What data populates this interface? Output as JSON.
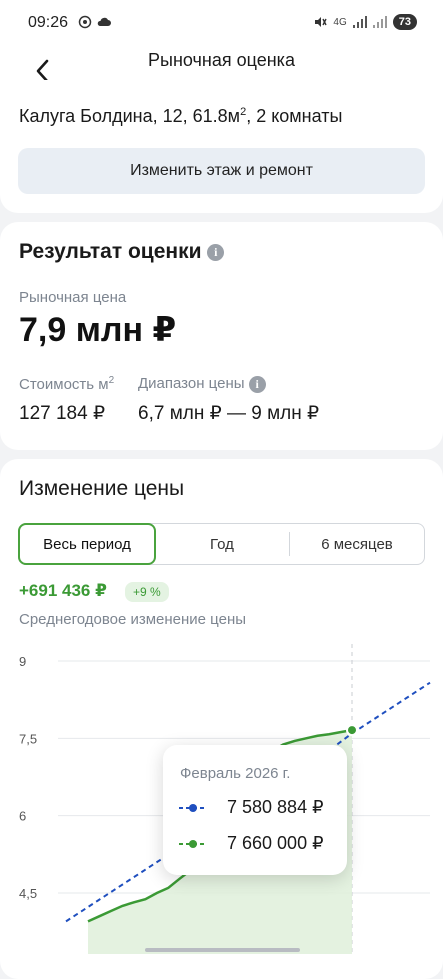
{
  "status_bar": {
    "time": "09:26",
    "network": "4G",
    "battery": "73"
  },
  "app_bar": {
    "title": "Рыночная оценка",
    "back_icon": "chevron-left-icon"
  },
  "property": {
    "address_prefix": "Калуга Болдина, 12, 61.8м",
    "area_sup": "2",
    "address_suffix": ", 2 комнаты",
    "change_button": "Изменить этаж и ремонт"
  },
  "valuation": {
    "title": "Результат оценки",
    "market_price_label": "Рыночная цена",
    "market_price": "7,9 млн ₽",
    "cost_per_m2_label": "Стоимость м",
    "cost_per_m2_sup": "2",
    "cost_per_m2": "127 184 ₽",
    "range_label": "Диапазон цены",
    "range": "6,7 млн ₽ — 9 млн ₽",
    "info_icon": "info-icon"
  },
  "price_change": {
    "title": "Изменение цены",
    "tabs": [
      "Весь период",
      "Год",
      "6 месяцев"
    ],
    "active_tab": 0,
    "change_value": "+691 436 ₽",
    "change_percent": "+9 %",
    "description": "Среднегодовое изменение цены",
    "accent_color": "#3b9a35",
    "trend_color": "#1f4fbf"
  },
  "chart_data": {
    "type": "line",
    "y_tick_labels": [
      "9",
      "7,5",
      "6",
      "4,5"
    ],
    "ylim": [
      4.0,
      9.0
    ],
    "grid": true,
    "series": [
      {
        "style": "solid-green-area",
        "values": [
          3.95,
          4.05,
          4.15,
          4.25,
          4.32,
          4.38,
          4.5,
          4.6,
          4.78,
          4.95,
          5.3,
          5.9,
          6.35,
          6.7,
          6.95,
          7.1,
          7.25,
          7.38,
          7.45,
          7.5,
          7.55,
          7.58,
          7.62,
          7.66
        ]
      },
      {
        "style": "dashed-blue-trend",
        "values": [
          3.95,
          4.15,
          4.35,
          4.55,
          4.75,
          4.95,
          5.15,
          5.35,
          5.55,
          5.75,
          5.95,
          6.15,
          6.35,
          6.55,
          6.75,
          6.95,
          7.15,
          7.35,
          7.58,
          7.78,
          7.98,
          8.18,
          8.38,
          8.58
        ]
      }
    ],
    "tooltip": {
      "title": "Февраль 2026 г.",
      "trend_value": "7 580 884 ₽",
      "actual_value": "7 660 000 ₽"
    }
  }
}
